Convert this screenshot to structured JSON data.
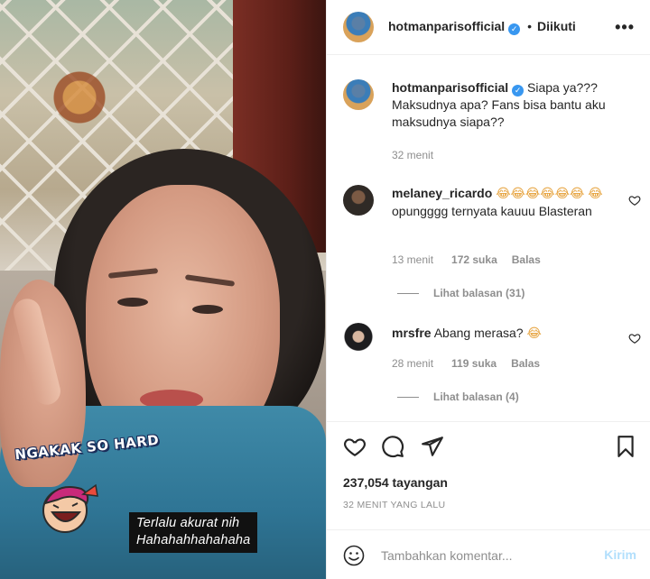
{
  "header": {
    "username": "hotmanparisofficial",
    "follow_state": "Diikuti",
    "more_label": "•••"
  },
  "caption": {
    "username": "hotmanparisofficial",
    "text": "Siapa ya??? Maksudnya apa? Fans bisa bantu aku maksudnya siapa??",
    "time": "32 menit"
  },
  "comments": [
    {
      "username": "melaney_ricardo",
      "emojis": "😂😂😂😂😂😂",
      "emoji_lead": "😂",
      "text": "opungggg ternyata kauuu Blasteran",
      "time": "13 menit",
      "likes": "172 suka",
      "reply_label": "Balas",
      "view_replies": "Lihat balasan (31)"
    },
    {
      "username": "mrsfre",
      "text": "Abang merasa?",
      "emoji_tail": "😂",
      "time": "28 menit",
      "likes": "119 suka",
      "reply_label": "Balas",
      "view_replies": "Lihat balasan (4)"
    }
  ],
  "post": {
    "views": "237,054 tayangan",
    "time_ago": "32 MENIT YANG LALU"
  },
  "composer": {
    "placeholder": "Tambahkan komentar...",
    "post_label": "Kirim"
  },
  "video_overlay": {
    "sticker_text": "NGAKAK SO HARD",
    "caption_lines": [
      "Terlalu akurat nih",
      "Hahahahhahahaha"
    ]
  },
  "colors": {
    "verified": "#3897f0",
    "muted": "#8e8e8e",
    "post_disabled": "#b2dffc"
  }
}
